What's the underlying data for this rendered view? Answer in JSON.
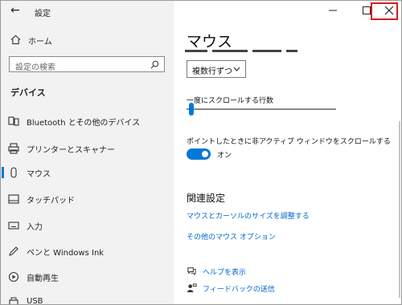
{
  "window": {
    "title": "設定",
    "controls": {
      "minimize": "minimize-icon",
      "maximize": "maximize-icon",
      "close": "close-icon"
    },
    "highlight_color": "#e3161b"
  },
  "sidebar": {
    "home_label": "ホーム",
    "search_placeholder": "設定の検索",
    "section_label": "デバイス",
    "items": [
      {
        "label": "Bluetooth とその他のデバイス",
        "icon": "bluetooth-devices-icon"
      },
      {
        "label": "プリンターとスキャナー",
        "icon": "printer-icon"
      },
      {
        "label": "マウス",
        "icon": "mouse-icon",
        "active": true
      },
      {
        "label": "タッチパッド",
        "icon": "touchpad-icon"
      },
      {
        "label": "入力",
        "icon": "keyboard-icon"
      },
      {
        "label": "ペンと Windows Ink",
        "icon": "pen-icon"
      },
      {
        "label": "自動再生",
        "icon": "autoplay-icon"
      },
      {
        "label": "USB",
        "icon": "usb-icon"
      }
    ]
  },
  "main": {
    "heading": "マウス",
    "scroll_lines_select": {
      "selected": "複数行ずつ"
    },
    "lines_label": "一度にスクロールする行数",
    "lines_slider_value": 0.02,
    "inactive_scroll_label": "ポイントしたときに非アクティブ ウィンドウをスクロールする",
    "toggle_state": "オン",
    "related_heading": "関連設定",
    "links": [
      "マウスとカーソルのサイズを調整する",
      "その他のマウス オプション"
    ],
    "help_label": "ヘルプを表示",
    "feedback_label": "フィードバックの送信"
  },
  "accent_color": "#0078d7"
}
